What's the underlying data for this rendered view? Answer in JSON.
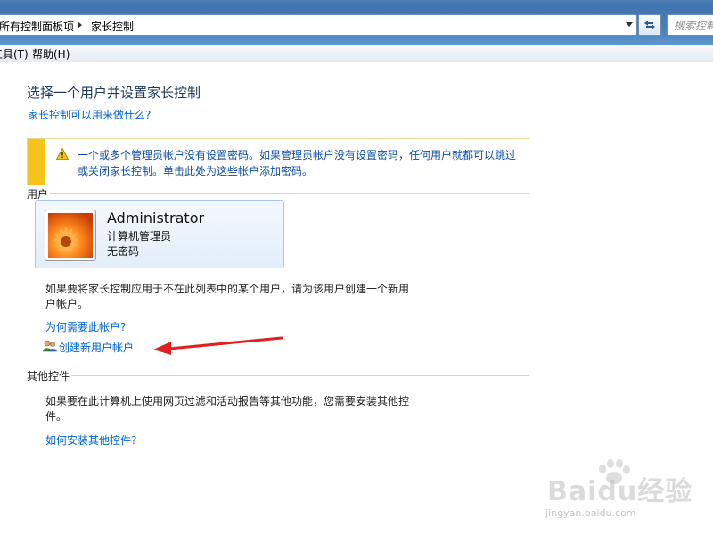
{
  "addressbar": {
    "crumb1": "所有控制面板项",
    "crumb2": "家长控制",
    "search_placeholder": "搜索控制面板"
  },
  "menubar": {
    "tools": "工具(T)",
    "help": "帮助(H)"
  },
  "main": {
    "title": "选择一个用户并设置家长控制",
    "what_link": "家长控制可以用来做什么?",
    "warning_text": "一个或多个管理员帐户没有设置密码。如果管理员帐户没有设置密码，任何用户就都可以跳过或关闭家长控制。单击此处为这些帐户添加密码。",
    "users_label": "用户",
    "user": {
      "name": "Administrator",
      "role": "计算机管理员",
      "password_status": "无密码"
    },
    "not_listed_text": "如果要将家长控制应用于不在此列表中的某个用户，请为该用户创建一个新用户帐户。",
    "why_link": "为何需要此帐户?",
    "create_link": "创建新用户帐户",
    "other_controls_label": "其他控件",
    "other_controls_text": "如果要在此计算机上使用网页过滤和活动报告等其他功能，您需要安装其他控件。",
    "install_link": "如何安装其他控件?"
  },
  "watermark": {
    "brand": "Baidu经验",
    "url": "jingyan.baidu.com"
  },
  "colors": {
    "link": "#0066cc",
    "title": "#1e395b",
    "warning_stripe": "#f6c31c",
    "arrow": "#e02020"
  }
}
